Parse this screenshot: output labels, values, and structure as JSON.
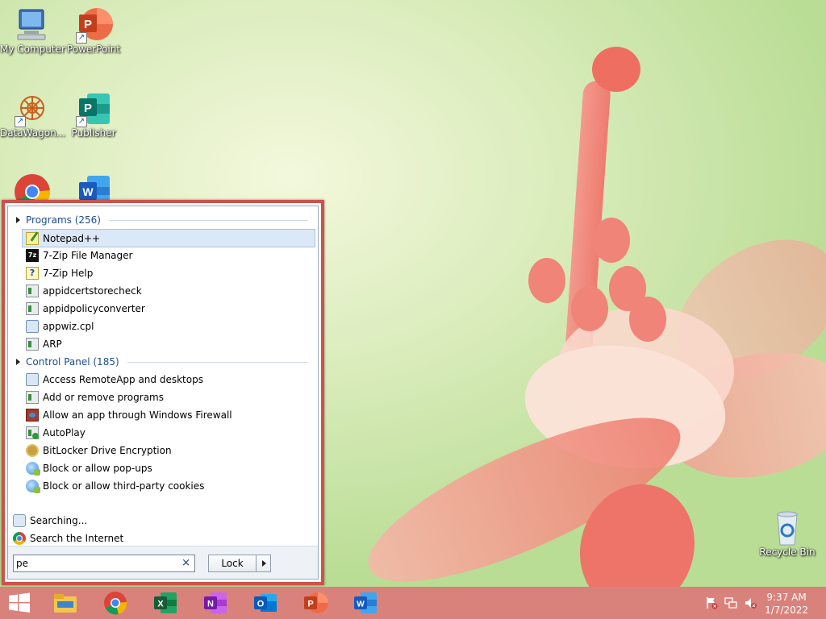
{
  "desktop": {
    "icons": [
      {
        "label": "My Computer",
        "icon": "computer-icon"
      },
      {
        "label": "PowerPoint",
        "icon": "powerpoint-icon"
      },
      {
        "label": "DataWagon...",
        "icon": "datawagon-icon"
      },
      {
        "label": "Publisher",
        "icon": "publisher-icon"
      },
      {
        "label": "",
        "icon": "chrome-icon"
      },
      {
        "label": "",
        "icon": "word-icon"
      },
      {
        "label": "Recycle Bin",
        "icon": "recycle-bin-icon"
      }
    ]
  },
  "startmenu": {
    "groups": [
      {
        "label": "Programs (256)",
        "items": [
          {
            "label": "Notepad++",
            "icon": "notepad-plus-plus-icon",
            "selected": true
          },
          {
            "label": "7-Zip File Manager",
            "icon": "seven-zip-icon"
          },
          {
            "label": "7-Zip Help",
            "icon": "help-icon"
          },
          {
            "label": "appidcertstorecheck",
            "icon": "exe-icon"
          },
          {
            "label": "appidpolicyconverter",
            "icon": "exe-icon"
          },
          {
            "label": "appwiz.cpl",
            "icon": "cpl-icon"
          },
          {
            "label": "ARP",
            "icon": "exe-icon"
          }
        ]
      },
      {
        "label": "Control Panel (185)",
        "items": [
          {
            "label": "Access RemoteApp and desktops",
            "icon": "remoteapp-icon"
          },
          {
            "label": "Add or remove programs",
            "icon": "programs-icon"
          },
          {
            "label": "Allow an app through Windows Firewall",
            "icon": "firewall-icon"
          },
          {
            "label": "AutoPlay",
            "icon": "autoplay-icon"
          },
          {
            "label": "BitLocker Drive Encryption",
            "icon": "bitlocker-icon"
          },
          {
            "label": "Block or allow pop-ups",
            "icon": "internet-options-icon"
          },
          {
            "label": "Block or allow third-party cookies",
            "icon": "internet-options-icon"
          }
        ]
      }
    ],
    "searching_label": "Searching...",
    "search_internet_label": "Search the Internet",
    "search_value": "pe",
    "clear_glyph": "×",
    "lock_label": "Lock"
  },
  "taskbar": {
    "apps": [
      "start-icon",
      "file-explorer-icon",
      "chrome-icon",
      "excel-icon",
      "onenote-icon",
      "outlook-icon",
      "powerpoint-icon",
      "word-icon"
    ],
    "tray": [
      "action-center-flag-icon",
      "network-icon",
      "volume-muted-icon"
    ],
    "time": "9:37 AM",
    "date": "1/7/2022"
  },
  "colors": {
    "accent": "#cd524b",
    "taskbar": "#d9817b",
    "group_text": "#1e4c8d",
    "selection": "#dbe8f8"
  }
}
